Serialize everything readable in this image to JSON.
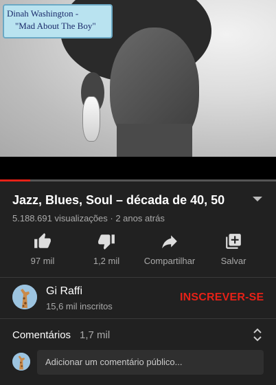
{
  "video": {
    "caption_line1": "Dinah Washington -",
    "caption_line2": "\"Mad About The Boy\"",
    "progress_fraction": 0.11,
    "progress_color": "#e62117"
  },
  "title": "Jazz, Blues, Soul – década de 40, 50",
  "meta": "5.188.691 visualizações · 2 anos atrás",
  "actions": [
    {
      "icon": "thumbs-up-icon",
      "label": "97 mil"
    },
    {
      "icon": "thumbs-down-icon",
      "label": "1,2 mil"
    },
    {
      "icon": "share-icon",
      "label": "Compartilhar"
    },
    {
      "icon": "add-to-playlist-icon",
      "label": "Salvar"
    }
  ],
  "channel": {
    "name": "Gi Raffi",
    "subscribers": "15,6 mil inscritos",
    "subscribe_label": "INSCREVER-SE",
    "subscribe_color": "#e62117"
  },
  "comments": {
    "label": "Comentários",
    "count": "1,7 mil",
    "placeholder": "Adicionar um comentário público..."
  }
}
